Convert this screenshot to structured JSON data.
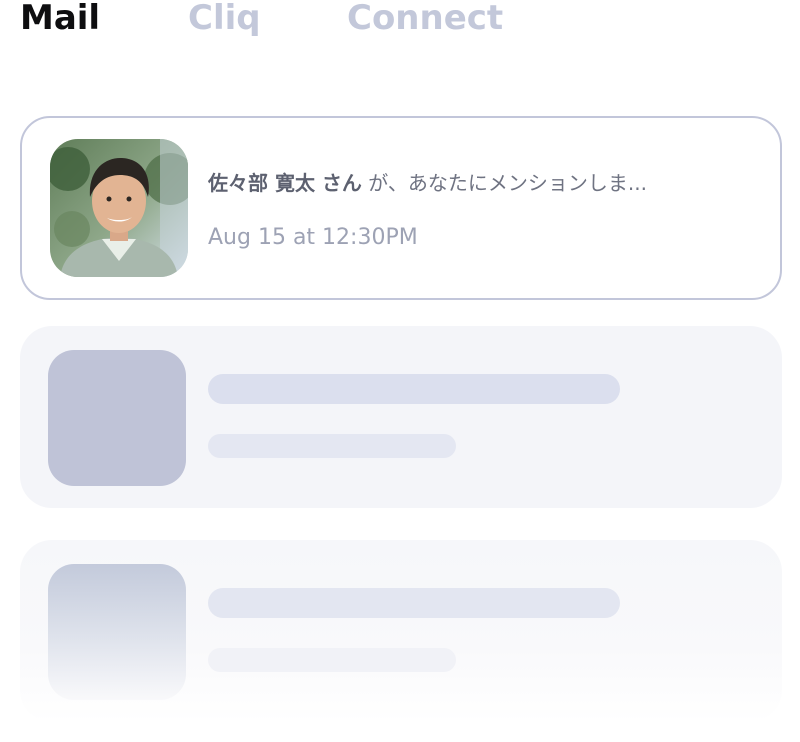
{
  "tabs": [
    {
      "label": "Mail",
      "active": true
    },
    {
      "label": "Cliq",
      "active": false
    },
    {
      "label": "Connect",
      "active": false
    }
  ],
  "notification": {
    "sender": "佐々部 寛太 さん",
    "message": " が、あなたにメンションしま...",
    "timestamp": "Aug 15 at 12:30PM",
    "avatar_icon": "person-photo"
  },
  "placeholders": [
    {
      "state": "loading"
    },
    {
      "state": "loading"
    }
  ],
  "colors": {
    "tab_active": "#0e0e10",
    "tab_inactive": "#c3c8da",
    "card_border": "#c2c6da",
    "skeleton_card": "#f4f5f9",
    "skeleton_thumb": "#bfc3d7",
    "skeleton_line": "#dbdfee",
    "text_secondary": "#9da2b4"
  }
}
